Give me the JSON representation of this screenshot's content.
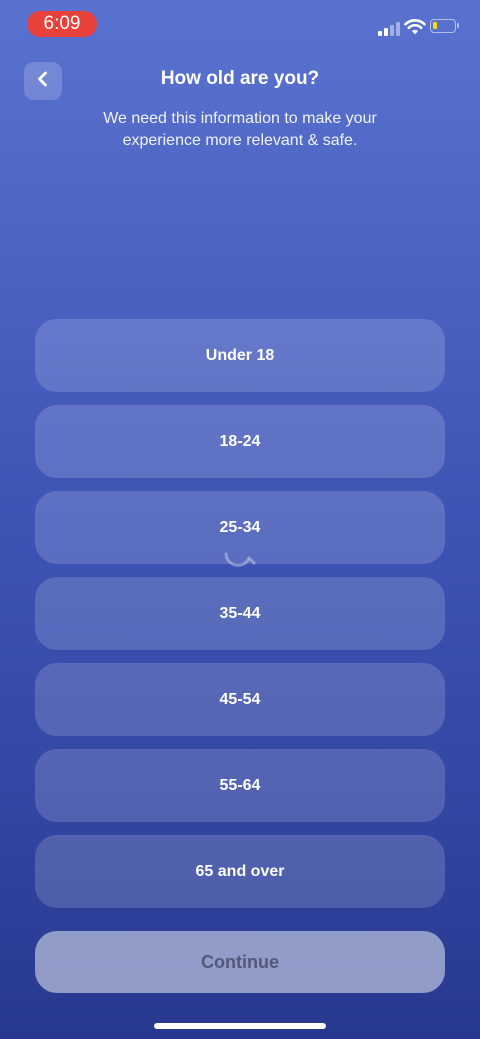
{
  "status_bar": {
    "time": "6:09",
    "signal_icon": "cellular-signal-icon",
    "wifi_icon": "wifi-icon",
    "battery_icon": "battery-low-icon",
    "battery_level": 0.15,
    "time_pill_color": "#e8403a",
    "battery_fill_color": "#f5d90a"
  },
  "header": {
    "back_icon": "chevron-left-icon",
    "title": "How old are you?",
    "subtitle": "We need this information to make your experience more relevant & safe."
  },
  "age_options": [
    {
      "label": "Under 18"
    },
    {
      "label": "18-24"
    },
    {
      "label": "25-34"
    },
    {
      "label": "35-44"
    },
    {
      "label": "45-54"
    },
    {
      "label": "55-64"
    },
    {
      "label": "65 and over"
    }
  ],
  "continue": {
    "label": "Continue",
    "enabled": false
  },
  "colors": {
    "background_top": "#5a72cf",
    "background_bottom": "#28388f"
  }
}
